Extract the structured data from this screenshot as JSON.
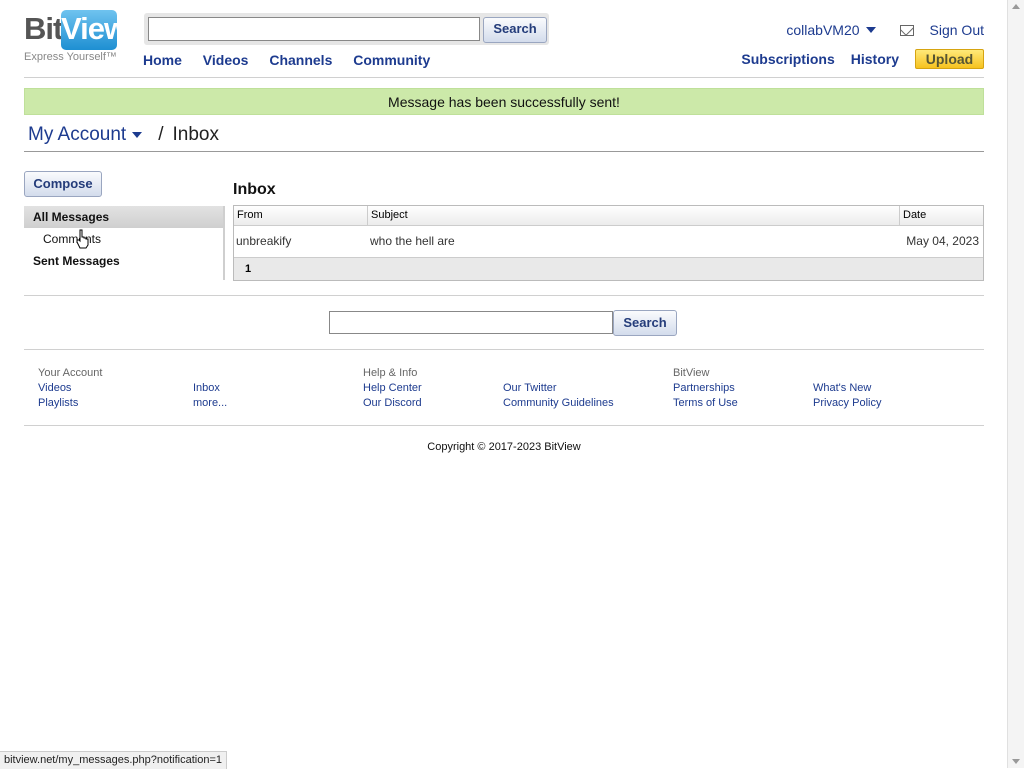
{
  "logo": {
    "part1": "Bit",
    "part2": "View",
    "tagline": "Express Yourself™"
  },
  "header": {
    "search_placeholder": "",
    "search_button": "Search",
    "nav": [
      "Home",
      "Videos",
      "Channels",
      "Community"
    ],
    "username": "collabVM20",
    "sign_out": "Sign Out",
    "right_nav": [
      "Subscriptions",
      "History"
    ],
    "upload": "Upload"
  },
  "notice": "Message has been successfully sent!",
  "breadcrumb": {
    "account": "My Account",
    "separator": "/",
    "current": "Inbox"
  },
  "sidebar": {
    "compose": "Compose",
    "items": [
      "All Messages",
      "Comments",
      "Sent Messages"
    ]
  },
  "inbox": {
    "title": "Inbox",
    "columns": [
      "From",
      "Subject",
      "Date"
    ],
    "rows": [
      {
        "from": "unbreakify",
        "subject": "who the hell are",
        "date": "May 04, 2023"
      }
    ],
    "page": "1"
  },
  "bottom_search": {
    "button": "Search"
  },
  "footer": {
    "col1": {
      "heading": "Your Account",
      "links": [
        "Videos",
        "Playlists"
      ]
    },
    "col2": {
      "heading": "",
      "links": [
        "Inbox",
        "more..."
      ]
    },
    "col3": {
      "heading": "Help & Info",
      "links": [
        "Help Center",
        "Our Discord"
      ]
    },
    "col4": {
      "heading": "",
      "links": [
        "Our Twitter",
        "Community Guidelines"
      ]
    },
    "col5": {
      "heading": "BitView",
      "links": [
        "Partnerships",
        "Terms of Use"
      ]
    },
    "col6": {
      "heading": "",
      "links": [
        "What's New",
        "Privacy Policy"
      ]
    },
    "copyright": "Copyright © 2017-2023 BitView"
  },
  "statusbar": "bitview.net/my_messages.php?notification=1",
  "colors": {
    "link": "#1d3b8f",
    "notice_bg": "#cce9a9",
    "upload": "#f6c21f",
    "logo_blue": "#1e8fd2"
  }
}
